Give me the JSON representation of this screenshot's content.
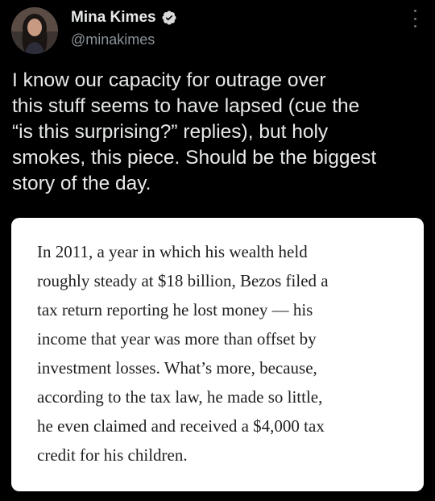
{
  "author": {
    "display_name": "Mina Kimes",
    "handle": "@minakimes",
    "verified": true,
    "avatar_icon": "profile-photo"
  },
  "menu": {
    "icon": "more-vertical-icon"
  },
  "tweet": {
    "lines": [
      "I know our capacity for outrage over",
      "this stuff seems to have lapsed (cue the",
      "“is this surprising?” replies), but holy",
      "smokes, this piece. Should be the biggest",
      "story of the day."
    ]
  },
  "quote": {
    "lines": [
      "In 2011, a year in which his wealth held",
      "roughly steady at $18 billion, Bezos filed a",
      "tax return reporting he lost money — his",
      "income that year was more than offset by",
      "investment losses. What’s more, because,",
      "according to the tax law, he made so little,",
      "he even claimed and received a $4,000 tax",
      "credit for his children."
    ]
  },
  "colors": {
    "background": "#000000",
    "primary_text": "#e7e9ea",
    "secondary_text": "#8b9298",
    "verified_badge": "#d9d9d9",
    "card_background": "#ffffff",
    "card_text": "#202020"
  }
}
